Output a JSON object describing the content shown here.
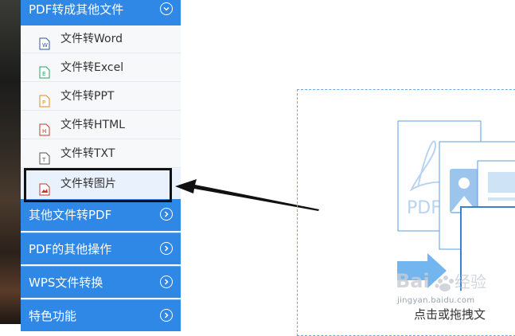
{
  "sidebar": {
    "header": {
      "label": "PDF转成其他文件"
    },
    "items": [
      {
        "label": "文件转Word",
        "icon": "word-file-icon",
        "color": "#2b579a"
      },
      {
        "label": "文件转Excel",
        "icon": "excel-file-icon",
        "color": "#21a366"
      },
      {
        "label": "文件转PPT",
        "icon": "ppt-file-icon",
        "color": "#d98a2b"
      },
      {
        "label": "文件转HTML",
        "icon": "html-file-icon",
        "color": "#c0392b"
      },
      {
        "label": "文件转TXT",
        "icon": "txt-file-icon",
        "color": "#555555"
      },
      {
        "label": "文件转图片",
        "icon": "image-file-icon",
        "color": "#c0392b",
        "selected": true
      }
    ],
    "categories": [
      {
        "label": "其他文件转PDF"
      },
      {
        "label": "PDF的其他操作"
      },
      {
        "label": "WPS文件转换"
      },
      {
        "label": "特色功能"
      }
    ]
  },
  "main": {
    "illustration_text": "PDF",
    "bottom_hint": "点击或拖拽文"
  },
  "watermark": {
    "logo": "Bai du 经验",
    "site": "jingyan.baidu.com"
  },
  "colors": {
    "accent": "#2f87e6",
    "sidebar_bg": "#f7f8fa",
    "selected_bg": "#e8f1fc"
  }
}
